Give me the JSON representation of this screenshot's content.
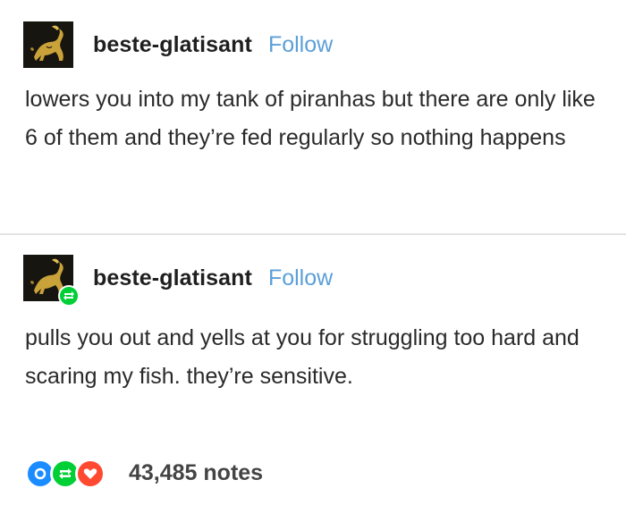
{
  "posts": [
    {
      "username": "beste-glatisant",
      "follow_label": "Follow",
      "body": "lowers you into my tank of piranhas but there are only like 6 of them and they’re fed regularly so nothing happens"
    },
    {
      "username": "beste-glatisant",
      "follow_label": "Follow",
      "body": "pulls you out and yells at you for struggling too hard and scaring my fish. they’re sensitive."
    }
  ],
  "notes": {
    "count_label": "43,485 notes"
  },
  "colors": {
    "follow": "#5b9fd8",
    "reblog": "#00cf35",
    "reply": "#1a8cff",
    "like": "#ff4930"
  },
  "icons": [
    "avatar-icon",
    "reblog-icon",
    "reply-icon",
    "like-icon"
  ]
}
